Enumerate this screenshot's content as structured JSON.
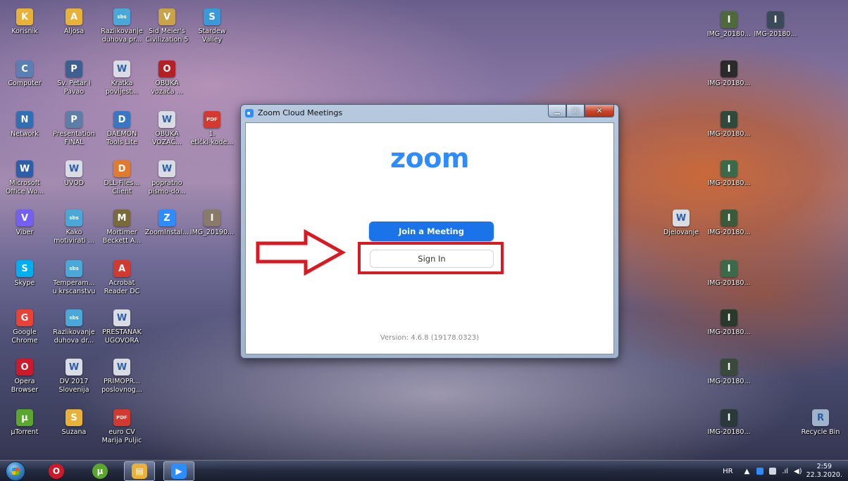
{
  "desktop": {
    "icons": [
      {
        "id": "korisnik",
        "label": "Korisnik",
        "glyph": "K",
        "color": "#e8b23a"
      },
      {
        "id": "aljosa",
        "label": "Aljosa",
        "glyph": "A",
        "color": "#e8b23a"
      },
      {
        "id": "razlikovanje1",
        "label": "Razlikovanje\nduhova pr...",
        "glyph": "sbs",
        "color": "#4aa8d8"
      },
      {
        "id": "civ5",
        "label": "Sid Meier's\nCivilization 5",
        "glyph": "V",
        "color": "#c9a24a"
      },
      {
        "id": "stardew",
        "label": "Stardew\nValley",
        "glyph": "S",
        "color": "#3a9ad9"
      },
      {
        "id": "computer",
        "label": "Computer",
        "glyph": "C",
        "color": "#5a7fb5"
      },
      {
        "id": "petar",
        "label": "Sv. Petar i\nPavao",
        "glyph": "P",
        "color": "#3d5f92"
      },
      {
        "id": "kratka",
        "label": "Kratka\npovijest...",
        "glyph": "W",
        "color": "#d9dde3"
      },
      {
        "id": "obuka1",
        "label": "OBUKA\nvozača ...",
        "glyph": "O",
        "color": "#b52025"
      },
      {
        "id": "network",
        "label": "Network",
        "glyph": "N",
        "color": "#2f6fb6"
      },
      {
        "id": "presentation",
        "label": "Presentation\nFINAL",
        "glyph": "P",
        "color": "#5d7ea8"
      },
      {
        "id": "daemon",
        "label": "DAEMON\nTools Lite",
        "glyph": "D",
        "color": "#3a77c2"
      },
      {
        "id": "obuka2",
        "label": "OBUKA\nVOZAČ...",
        "glyph": "W",
        "color": "#d9dde3"
      },
      {
        "id": "eticki",
        "label": "1.\netički-kode...",
        "glyph": "PDF",
        "color": "#d33a2f"
      },
      {
        "id": "msoffice",
        "label": "Microsoft\nOffice Wo...",
        "glyph": "W",
        "color": "#2c5fa8"
      },
      {
        "id": "uvod",
        "label": "UVOD",
        "glyph": "W",
        "color": "#d9dde3"
      },
      {
        "id": "dllfiles",
        "label": "DLL-Files...\nClient",
        "glyph": "D",
        "color": "#e07a2e"
      },
      {
        "id": "popratno",
        "label": "popratno\npismo-do...",
        "glyph": "W",
        "color": "#d9dde3"
      },
      {
        "id": "viber",
        "label": "Viber",
        "glyph": "V",
        "color": "#7360f2"
      },
      {
        "id": "kako",
        "label": "Kako\nmotivirati ...",
        "glyph": "sbs",
        "color": "#4aa8d8"
      },
      {
        "id": "mortimer",
        "label": "Mortimer\nBeckett A...",
        "glyph": "M",
        "color": "#7a6a3a"
      },
      {
        "id": "zoominstal",
        "label": "ZoomInstal...",
        "glyph": "Z",
        "color": "#2d8cff"
      },
      {
        "id": "img2019",
        "label": "IMG_20190...",
        "glyph": "I",
        "color": "#8a7a6a"
      },
      {
        "id": "skype",
        "label": "Skype",
        "glyph": "S",
        "color": "#00aff0"
      },
      {
        "id": "temperam",
        "label": "Temperam...\nu krscanstvu",
        "glyph": "sbs",
        "color": "#4aa8d8"
      },
      {
        "id": "acrobat",
        "label": "Acrobat\nReader DC",
        "glyph": "A",
        "color": "#d33a2f"
      },
      {
        "id": "chrome",
        "label": "Google\nChrome",
        "glyph": "G",
        "color": "#e94235"
      },
      {
        "id": "razlikovanje2",
        "label": "Razlikovanje\nduhova dr...",
        "glyph": "sbs",
        "color": "#4aa8d8"
      },
      {
        "id": "prestanak",
        "label": "PRESTANAK\nUGOVORA",
        "glyph": "W",
        "color": "#d9dde3"
      },
      {
        "id": "opera",
        "label": "Opera\nBrowser",
        "glyph": "O",
        "color": "#cc1a2a"
      },
      {
        "id": "dv2017",
        "label": "DV 2017\nSlovenija",
        "glyph": "W",
        "color": "#d9dde3"
      },
      {
        "id": "primopr",
        "label": "PRIMOPR...\nposlovnog...",
        "glyph": "W",
        "color": "#d9dde3"
      },
      {
        "id": "utorrent",
        "label": "µTorrent",
        "glyph": "µ",
        "color": "#5aa72f"
      },
      {
        "id": "suzana",
        "label": "Suzana",
        "glyph": "S",
        "color": "#e8b23a"
      },
      {
        "id": "eurocv",
        "label": "euro CV\nMarija Puljic",
        "glyph": "PDF",
        "color": "#d33a2f"
      },
      {
        "id": "img_r1",
        "label": "IMG_20180...",
        "glyph": "I",
        "color": "#4f6a3a"
      },
      {
        "id": "img_r2",
        "label": "IMG-20180...",
        "glyph": "I",
        "color": "#3a4a5a"
      },
      {
        "id": "img_r3",
        "label": "IMG-20180...",
        "glyph": "I",
        "color": "#2a2a2a"
      },
      {
        "id": "img_r4",
        "label": "IMG-20180...",
        "glyph": "I",
        "color": "#2f4a3a"
      },
      {
        "id": "img_r5",
        "label": "IMG-20180...",
        "glyph": "I",
        "color": "#3a6a4a"
      },
      {
        "id": "djelovanje",
        "label": "Djelovanje",
        "glyph": "W",
        "color": "#d9dde3"
      },
      {
        "id": "img_r6",
        "label": "IMG-20180...",
        "glyph": "I",
        "color": "#3a5a3a"
      },
      {
        "id": "img_r7",
        "label": "IMG-20180...",
        "glyph": "I",
        "color": "#3a6a4a"
      },
      {
        "id": "img_r8",
        "label": "IMG-20180...",
        "glyph": "I",
        "color": "#2a3a2a"
      },
      {
        "id": "img_r9",
        "label": "IMG-20180...",
        "glyph": "I",
        "color": "#3a4a3a"
      },
      {
        "id": "img_r10",
        "label": "IMG-20180...",
        "glyph": "I",
        "color": "#2a3a3a"
      },
      {
        "id": "recycle",
        "label": "Recycle Bin",
        "glyph": "R",
        "color": "#9fb3cd"
      }
    ]
  },
  "zoom_window": {
    "title": "Zoom Cloud Meetings",
    "logo": "zoom",
    "join_label": "Join a Meeting",
    "signin_label": "Sign In",
    "version": "Version: 4.6.8 (19178.0323)",
    "controls": {
      "minimize": "▁",
      "maximize": "□",
      "close": "✕"
    }
  },
  "annotation": {
    "color": "#d81b23"
  },
  "taskbar": {
    "pinned": [
      {
        "id": "opera",
        "glyph": "O",
        "color": "#cc1a2a"
      },
      {
        "id": "utorrent",
        "glyph": "µ",
        "color": "#5aa72f"
      },
      {
        "id": "explorer",
        "glyph": "▤",
        "color": "#e8b23a"
      },
      {
        "id": "zoom",
        "glyph": "▶",
        "color": "#2d8cff"
      }
    ],
    "language": "HR",
    "clock_time": "2:59",
    "clock_date": "22.3.2020."
  }
}
